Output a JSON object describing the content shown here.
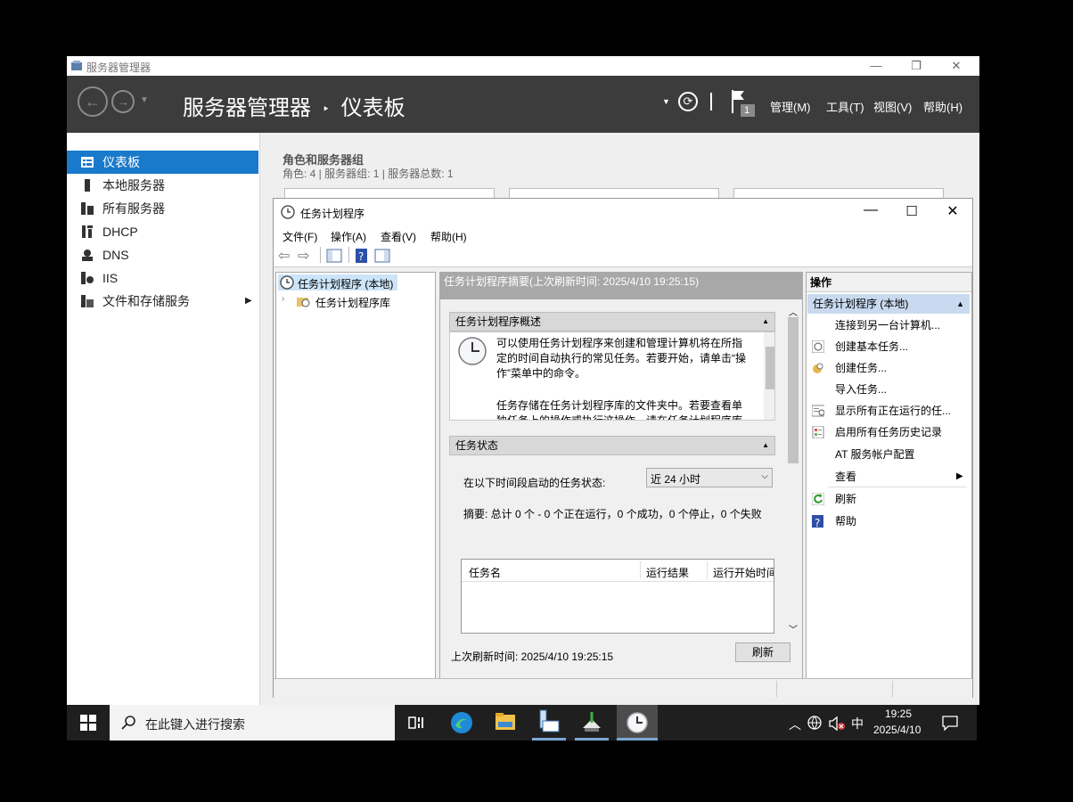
{
  "server_manager": {
    "window_title": "服务器管理器",
    "breadcrumb_app": "服务器管理器",
    "breadcrumb_sep": "‣",
    "breadcrumb_page": "仪表板",
    "flag_count": "1",
    "menus": [
      "管理(M)",
      "工具(T)",
      "视图(V)",
      "帮助(H)"
    ],
    "sidebar": [
      {
        "label": "仪表板",
        "icon": "dashboard-icon",
        "selected": true
      },
      {
        "label": "本地服务器",
        "icon": "server-icon"
      },
      {
        "label": "所有服务器",
        "icon": "servers-icon"
      },
      {
        "label": "DHCP",
        "icon": "dhcp-icon"
      },
      {
        "label": "DNS",
        "icon": "dns-icon"
      },
      {
        "label": "IIS",
        "icon": "iis-icon"
      },
      {
        "label": "文件和存储服务",
        "icon": "storage-icon",
        "has_arrow": true
      }
    ],
    "roles": {
      "heading": "角色和服务器组",
      "summary": "角色: 4 | 服务器组: 1 | 服务器总数: 1"
    }
  },
  "task_scheduler": {
    "window_title": "任务计划程序",
    "menus": [
      "文件(F)",
      "操作(A)",
      "查看(V)",
      "帮助(H)"
    ],
    "tree": {
      "root": "任务计划程序 (本地)",
      "child": "任务计划程序库"
    },
    "center": {
      "header": "任务计划程序摘要(上次刷新时间: 2025/4/10 19:25:15)",
      "overview_title": "任务计划程序概述",
      "overview_text_1": "可以使用任务计划程序来创建和管理计算机将在所指定的时间自动执行的常见任务。若要开始，请单击“操作”菜单中的命令。",
      "overview_text_2": "任务存储在任务计划程序库的文件夹中。若要查看单独任务上的操作或执行这操作，请在任务计划程序库",
      "status_title": "任务状态",
      "status_label": "在以下时间段启动的任务状态:",
      "status_select": "近 24 小时",
      "summary": "摘要: 总计 0 个 - 0 个正在运行，0 个成功，0 个停止，0 个失败",
      "columns": [
        "任务名",
        "运行结果",
        "运行开始时间"
      ],
      "last_refresh": "上次刷新时间: 2025/4/10 19:25:15",
      "refresh_button": "刷新"
    },
    "actions": {
      "title": "操作",
      "group": "任务计划程序 (本地)",
      "items": [
        {
          "label": "连接到另一台计算机...",
          "icon": ""
        },
        {
          "label": "创建基本任务...",
          "icon": "basic-task-icon"
        },
        {
          "label": "创建任务...",
          "icon": "create-task-icon"
        },
        {
          "label": "导入任务...",
          "icon": ""
        },
        {
          "label": "显示所有正在运行的任...",
          "icon": "running-tasks-icon"
        },
        {
          "label": "启用所有任务历史记录",
          "icon": "history-icon"
        },
        {
          "label": "AT 服务帐户配置",
          "icon": ""
        },
        {
          "label": "查看",
          "icon": "",
          "submenu": true
        },
        {
          "label": "刷新",
          "icon": "refresh-icon"
        },
        {
          "label": "帮助",
          "icon": "help-icon"
        }
      ]
    }
  },
  "taskbar": {
    "search_placeholder": "在此键入进行搜索",
    "time": "19:25",
    "date": "2025/4/10",
    "ime": "中"
  }
}
